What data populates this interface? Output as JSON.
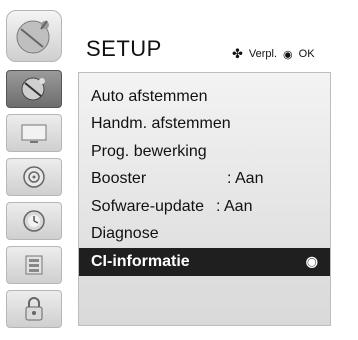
{
  "header": {
    "title": "SETUP",
    "nav_arrows": "✤",
    "nav_label": "Verpl.",
    "ok_symbol": "◉",
    "ok_label": "OK",
    "icon": "setup-satellite-icon"
  },
  "sidebar": {
    "items": [
      {
        "icon": "setup-icon",
        "active": true
      },
      {
        "icon": "picture-icon",
        "active": false
      },
      {
        "icon": "audio-icon",
        "active": false
      },
      {
        "icon": "time-icon",
        "active": false
      },
      {
        "icon": "option-icon",
        "active": false
      },
      {
        "icon": "lock-icon",
        "active": false
      }
    ]
  },
  "menu": {
    "items": [
      {
        "label": "Auto afstemmen",
        "value": ""
      },
      {
        "label": "Handm. afstemmen",
        "value": ""
      },
      {
        "label": "Prog. bewerking",
        "value": ""
      },
      {
        "label": "Booster",
        "value": ": Aan"
      },
      {
        "label": "Sofware-update",
        "value": ": Aan"
      },
      {
        "label": "Diagnose",
        "value": ""
      },
      {
        "label": "CI-informatie",
        "value": "",
        "selected": true,
        "ok_symbol": "◉"
      }
    ]
  },
  "colors": {
    "selected_bg": "#1f1f1f",
    "panel_bg": "#e6e6e6",
    "active_side": "#7a7a7a"
  }
}
